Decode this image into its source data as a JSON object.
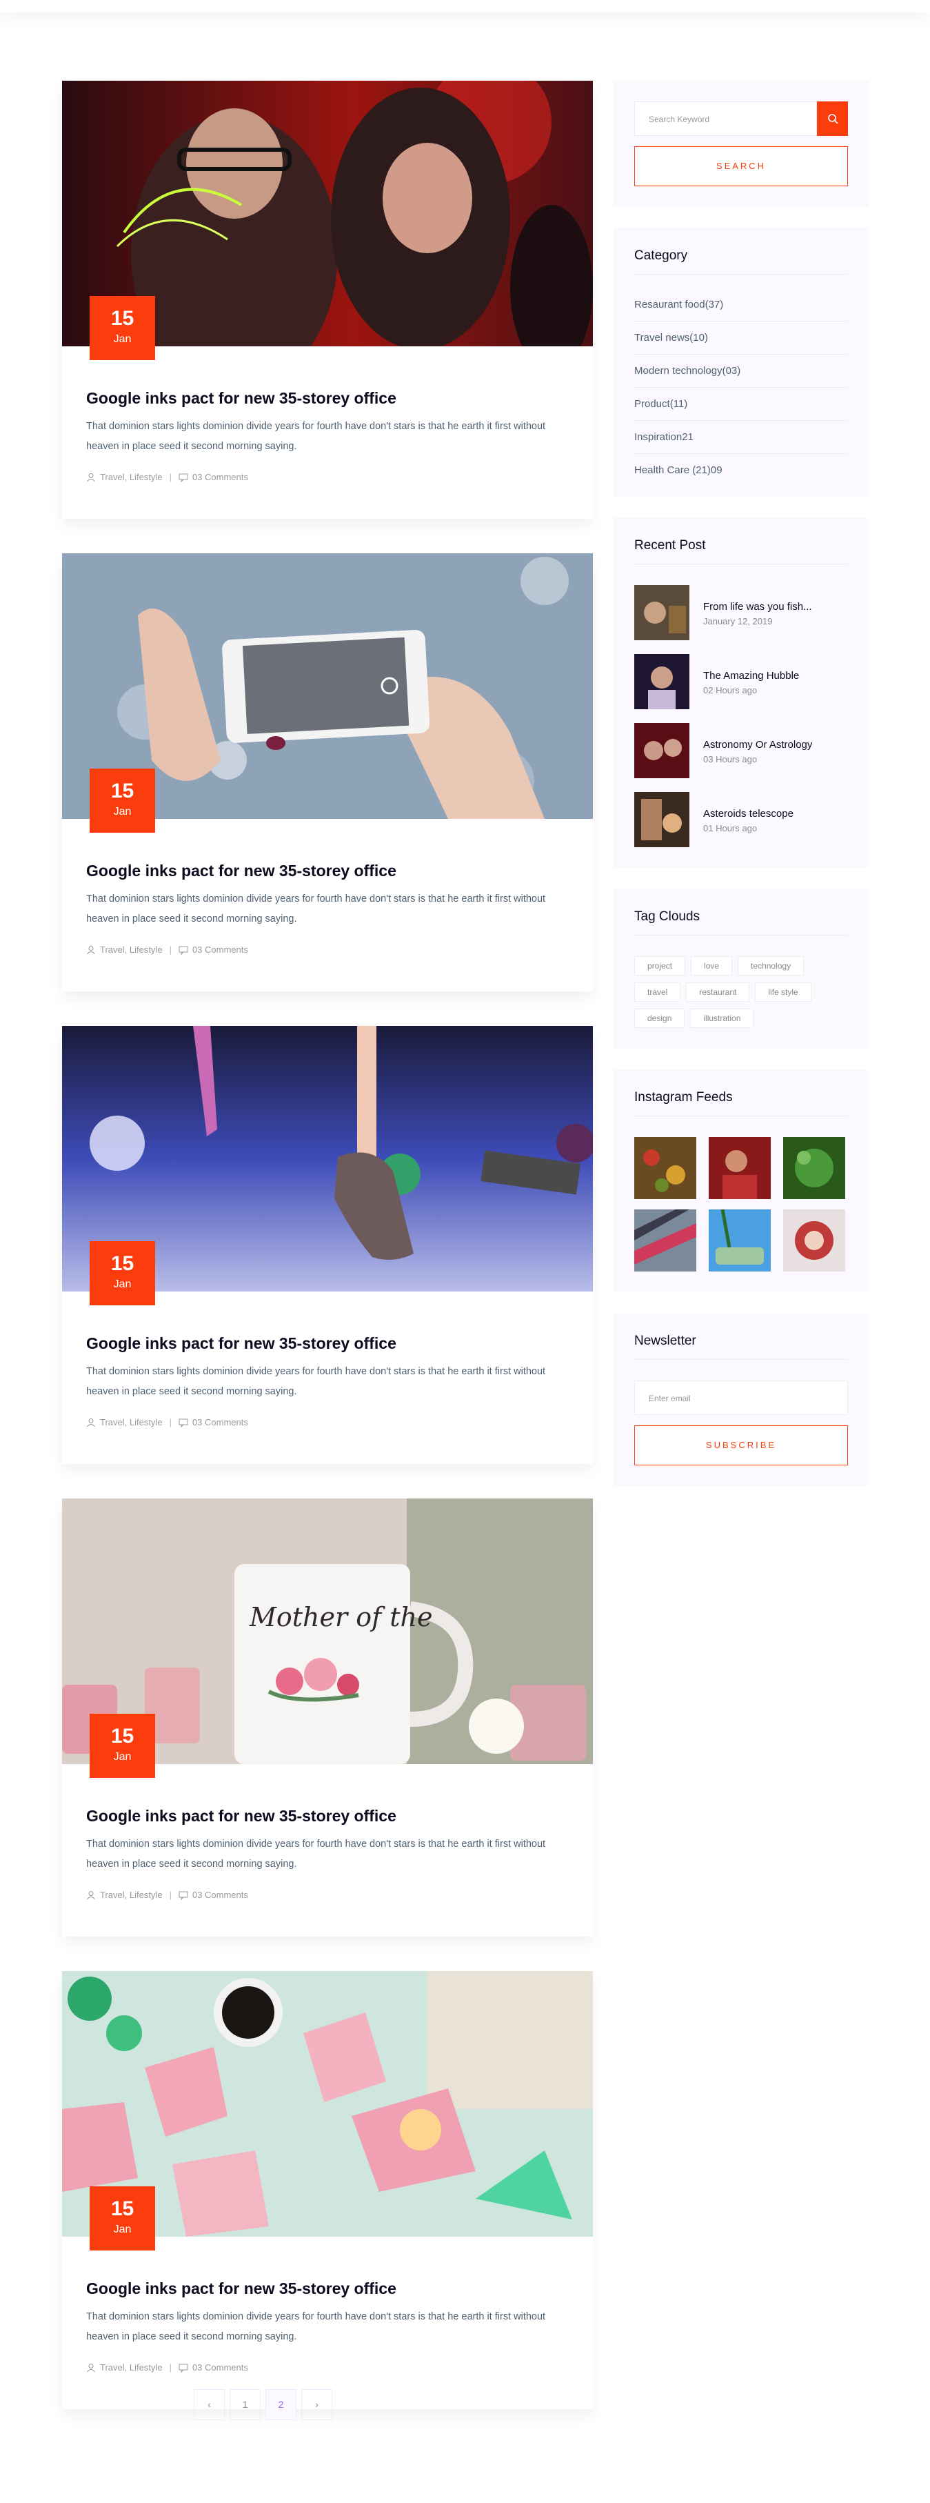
{
  "posts": [
    {
      "day": "15",
      "month": "Jan",
      "title": "Google inks pact for new 35-storey office",
      "excerpt": "That dominion stars lights dominion divide years for fourth have don't stars is that he earth it first without heaven in place seed it second morning saying.",
      "categories": "Travel, Lifestyle",
      "comments": "03 Comments"
    },
    {
      "day": "15",
      "month": "Jan",
      "title": "Google inks pact for new 35-storey office",
      "excerpt": "That dominion stars lights dominion divide years for fourth have don't stars is that he earth it first without heaven in place seed it second morning saying.",
      "categories": "Travel, Lifestyle",
      "comments": "03 Comments"
    },
    {
      "day": "15",
      "month": "Jan",
      "title": "Google inks pact for new 35-storey office",
      "excerpt": "That dominion stars lights dominion divide years for fourth have don't stars is that he earth it first without heaven in place seed it second morning saying.",
      "categories": "Travel, Lifestyle",
      "comments": "03 Comments"
    },
    {
      "day": "15",
      "month": "Jan",
      "title": "Google inks pact for new 35-storey office",
      "excerpt": "That dominion stars lights dominion divide years for fourth have don't stars is that he earth it first without heaven in place seed it second morning saying.",
      "categories": "Travel, Lifestyle",
      "comments": "03 Comments"
    },
    {
      "day": "15",
      "month": "Jan",
      "title": "Google inks pact for new 35-storey office",
      "excerpt": "That dominion stars lights dominion divide years for fourth have don't stars is that he earth it first without heaven in place seed it second morning saying.",
      "categories": "Travel, Lifestyle",
      "comments": "03 Comments"
    }
  ],
  "search": {
    "placeholder": "Search Keyword",
    "button_label": "SEARCH",
    "icon": "search-icon"
  },
  "category": {
    "title": "Category",
    "items": [
      "Resaurant food(37)",
      "Travel news(10)",
      "Modern technology(03)",
      "Product(11)",
      "Inspiration21",
      "Health Care (21)09"
    ]
  },
  "recent": {
    "title": "Recent Post",
    "items": [
      {
        "title": "From life was you fish...",
        "date": "January 12, 2019"
      },
      {
        "title": "The Amazing Hubble",
        "date": "02 Hours ago"
      },
      {
        "title": "Astronomy Or Astrology",
        "date": "03 Hours ago"
      },
      {
        "title": "Asteroids telescope",
        "date": "01 Hours ago"
      }
    ]
  },
  "tags": {
    "title": "Tag Clouds",
    "items": [
      "project",
      "love",
      "technology",
      "travel",
      "restaurant",
      "life style",
      "design",
      "illustration"
    ]
  },
  "instagram": {
    "title": "Instagram Feeds"
  },
  "newsletter": {
    "title": "Newsletter",
    "placeholder": "Enter email",
    "button_label": "SUBSCRIBE"
  },
  "pagination": {
    "prev_icon": "chevron-left-icon",
    "pages": [
      "1",
      "2"
    ],
    "active": "2",
    "next_icon": "chevron-right-icon"
  },
  "colors": {
    "accent": "#fb3c0d",
    "widget_bg": "#fbf9ff",
    "text_muted": "#506172"
  }
}
